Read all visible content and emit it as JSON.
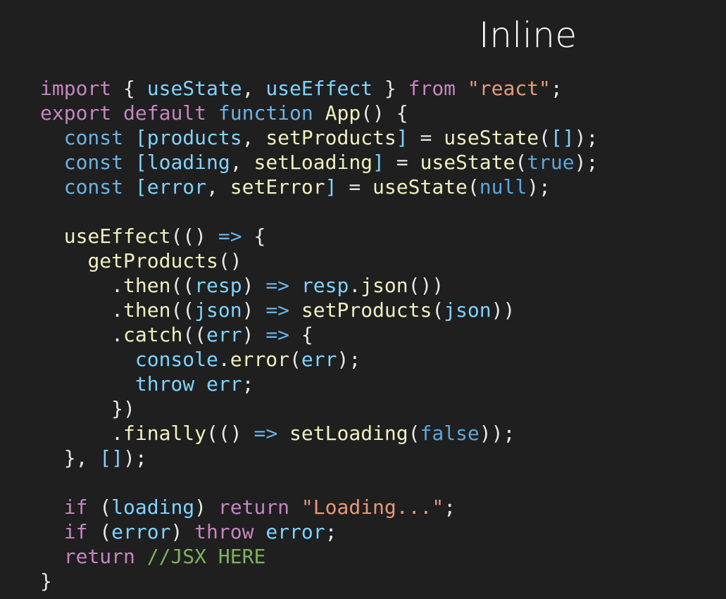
{
  "slide": {
    "title": "Inline"
  },
  "colors": {
    "background": "#1f1f1f",
    "keyword": "#c586c0",
    "declaration": "#6bb3e8",
    "function": "#f0f0c0",
    "variable": "#7fd3ff",
    "string": "#e59a7a",
    "literal": "#5aa7e0",
    "comment": "#7fb35c",
    "punctuation": "#e8e8e8"
  },
  "code": {
    "lines": [
      [
        [
          "t-kw",
          "import"
        ],
        [
          "t-punc",
          " { "
        ],
        [
          "t-var",
          "useState"
        ],
        [
          "t-punc",
          ", "
        ],
        [
          "t-var",
          "useEffect"
        ],
        [
          "t-punc",
          " } "
        ],
        [
          "t-kw",
          "from"
        ],
        [
          "t-punc",
          " "
        ],
        [
          "t-str",
          "\"react\""
        ],
        [
          "t-punc",
          ";"
        ]
      ],
      [
        [
          "t-kw",
          "export"
        ],
        [
          "t-punc",
          " "
        ],
        [
          "t-kw",
          "default"
        ],
        [
          "t-punc",
          " "
        ],
        [
          "t-decl",
          "function"
        ],
        [
          "t-punc",
          " "
        ],
        [
          "t-fn",
          "App"
        ],
        [
          "t-punc",
          "() {"
        ]
      ],
      [
        [
          "t-punc",
          "  "
        ],
        [
          "t-decl",
          "const"
        ],
        [
          "t-punc",
          " "
        ],
        [
          "t-bracket",
          "["
        ],
        [
          "t-var",
          "products"
        ],
        [
          "t-punc",
          ", "
        ],
        [
          "t-fn",
          "setProducts"
        ],
        [
          "t-bracket",
          "]"
        ],
        [
          "t-punc",
          " = "
        ],
        [
          "t-fn",
          "useState"
        ],
        [
          "t-punc",
          "("
        ],
        [
          "t-bracket",
          "[]"
        ],
        [
          "t-punc",
          ");"
        ]
      ],
      [
        [
          "t-punc",
          "  "
        ],
        [
          "t-decl",
          "const"
        ],
        [
          "t-punc",
          " "
        ],
        [
          "t-bracket",
          "["
        ],
        [
          "t-var",
          "loading"
        ],
        [
          "t-punc",
          ", "
        ],
        [
          "t-fn",
          "setLoading"
        ],
        [
          "t-bracket",
          "]"
        ],
        [
          "t-punc",
          " = "
        ],
        [
          "t-fn",
          "useState"
        ],
        [
          "t-punc",
          "("
        ],
        [
          "t-lit",
          "true"
        ],
        [
          "t-punc",
          ");"
        ]
      ],
      [
        [
          "t-punc",
          "  "
        ],
        [
          "t-decl",
          "const"
        ],
        [
          "t-punc",
          " "
        ],
        [
          "t-bracket",
          "["
        ],
        [
          "t-var",
          "error"
        ],
        [
          "t-punc",
          ", "
        ],
        [
          "t-fn",
          "setError"
        ],
        [
          "t-bracket",
          "]"
        ],
        [
          "t-punc",
          " = "
        ],
        [
          "t-fn",
          "useState"
        ],
        [
          "t-punc",
          "("
        ],
        [
          "t-lit",
          "null"
        ],
        [
          "t-punc",
          ");"
        ]
      ],
      [],
      [
        [
          "t-punc",
          "  "
        ],
        [
          "t-fn",
          "useEffect"
        ],
        [
          "t-punc",
          "(() "
        ],
        [
          "t-op",
          "=>"
        ],
        [
          "t-punc",
          " {"
        ]
      ],
      [
        [
          "t-punc",
          "    "
        ],
        [
          "t-fn",
          "getProducts"
        ],
        [
          "t-punc",
          "()"
        ]
      ],
      [
        [
          "t-punc",
          "      ."
        ],
        [
          "t-fn",
          "then"
        ],
        [
          "t-punc",
          "(("
        ],
        [
          "t-var",
          "resp"
        ],
        [
          "t-punc",
          ") "
        ],
        [
          "t-op",
          "=>"
        ],
        [
          "t-punc",
          " "
        ],
        [
          "t-var",
          "resp"
        ],
        [
          "t-punc",
          "."
        ],
        [
          "t-fn",
          "json"
        ],
        [
          "t-punc",
          "())"
        ]
      ],
      [
        [
          "t-punc",
          "      ."
        ],
        [
          "t-fn",
          "then"
        ],
        [
          "t-punc",
          "(("
        ],
        [
          "t-var",
          "json"
        ],
        [
          "t-punc",
          ") "
        ],
        [
          "t-op",
          "=>"
        ],
        [
          "t-punc",
          " "
        ],
        [
          "t-fn",
          "setProducts"
        ],
        [
          "t-punc",
          "("
        ],
        [
          "t-var",
          "json"
        ],
        [
          "t-punc",
          "))"
        ]
      ],
      [
        [
          "t-punc",
          "      ."
        ],
        [
          "t-fn",
          "catch"
        ],
        [
          "t-punc",
          "(("
        ],
        [
          "t-var",
          "err"
        ],
        [
          "t-punc",
          ") "
        ],
        [
          "t-op",
          "=>"
        ],
        [
          "t-punc",
          " {"
        ]
      ],
      [
        [
          "t-punc",
          "        "
        ],
        [
          "t-var",
          "console"
        ],
        [
          "t-punc",
          "."
        ],
        [
          "t-fn",
          "error"
        ],
        [
          "t-punc",
          "("
        ],
        [
          "t-var",
          "err"
        ],
        [
          "t-punc",
          ");"
        ]
      ],
      [
        [
          "t-punc",
          "        "
        ],
        [
          "t-var",
          "throw"
        ],
        [
          "t-punc",
          " "
        ],
        [
          "t-var",
          "err"
        ],
        [
          "t-punc",
          ";"
        ]
      ],
      [
        [
          "t-punc",
          "      })"
        ]
      ],
      [
        [
          "t-punc",
          "      ."
        ],
        [
          "t-fn",
          "finally"
        ],
        [
          "t-punc",
          "(() "
        ],
        [
          "t-op",
          "=>"
        ],
        [
          "t-punc",
          " "
        ],
        [
          "t-fn",
          "setLoading"
        ],
        [
          "t-punc",
          "("
        ],
        [
          "t-lit",
          "false"
        ],
        [
          "t-punc",
          "));"
        ]
      ],
      [
        [
          "t-punc",
          "  }, "
        ],
        [
          "t-bracket",
          "[]"
        ],
        [
          "t-punc",
          ");"
        ]
      ],
      [],
      [
        [
          "t-punc",
          "  "
        ],
        [
          "t-kw",
          "if"
        ],
        [
          "t-punc",
          " ("
        ],
        [
          "t-var",
          "loading"
        ],
        [
          "t-punc",
          ") "
        ],
        [
          "t-kw",
          "return"
        ],
        [
          "t-punc",
          " "
        ],
        [
          "t-str",
          "\"Loading...\""
        ],
        [
          "t-punc",
          ";"
        ]
      ],
      [
        [
          "t-punc",
          "  "
        ],
        [
          "t-kw",
          "if"
        ],
        [
          "t-punc",
          " ("
        ],
        [
          "t-var",
          "error"
        ],
        [
          "t-punc",
          ") "
        ],
        [
          "t-kw",
          "throw"
        ],
        [
          "t-punc",
          " "
        ],
        [
          "t-var",
          "error"
        ],
        [
          "t-punc",
          ";"
        ]
      ],
      [
        [
          "t-punc",
          "  "
        ],
        [
          "t-kw",
          "return"
        ],
        [
          "t-punc",
          " "
        ],
        [
          "t-cmt",
          "//JSX HERE"
        ]
      ],
      [
        [
          "t-punc",
          "}"
        ]
      ]
    ]
  }
}
